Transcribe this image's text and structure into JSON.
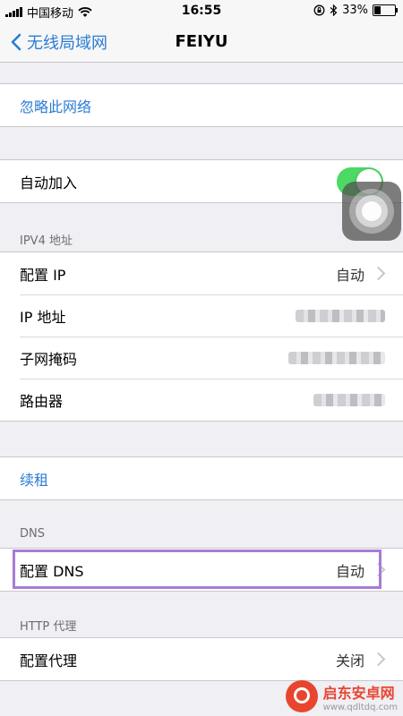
{
  "status_bar": {
    "carrier": "中国移动",
    "time": "16:55",
    "battery": "33%",
    "battery_level": 0.33
  },
  "nav": {
    "back_label": "无线局域网",
    "title": "FEIYU"
  },
  "forget_network": "忽略此网络",
  "auto_join": {
    "label": "自动加入",
    "on": true
  },
  "ipv4": {
    "header": "IPV4 地址",
    "configure_ip": {
      "label": "配置 IP",
      "value": "自动"
    },
    "ip_address": {
      "label": "IP 地址"
    },
    "subnet_mask": {
      "label": "子网掩码"
    },
    "router": {
      "label": "路由器"
    }
  },
  "renew_lease": "续租",
  "dns": {
    "header": "DNS",
    "configure_dns": {
      "label": "配置 DNS",
      "value": "自动"
    }
  },
  "http_proxy": {
    "header": "HTTP 代理",
    "configure_proxy": {
      "label": "配置代理",
      "value": "关闭"
    }
  },
  "watermark": {
    "title": "启东安卓网",
    "url": "www.qdltdq.com"
  },
  "colors": {
    "accent": "#2b7cd3",
    "toggle_on": "#4cd964",
    "highlight": "#a77bd6",
    "background": "#efeff4"
  },
  "icons": [
    "wifi-icon",
    "chevron-left-icon",
    "chevron-right-icon",
    "lock-rotation-icon",
    "bluetooth-icon",
    "battery-icon",
    "assistive-touch-icon"
  ]
}
